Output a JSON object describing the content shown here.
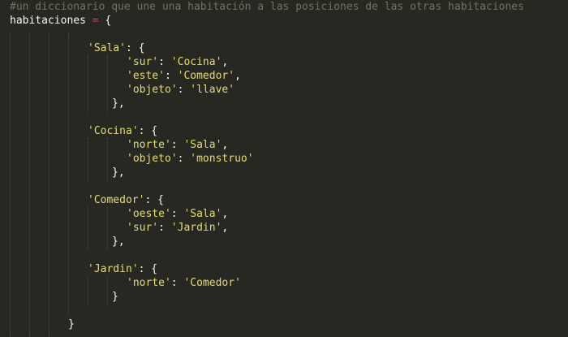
{
  "editor": {
    "comment": "#un diccionario que une una habitación a las posiciones de las otras habitaciones",
    "var_name": "habitaciones",
    "op_assign": "=",
    "open_brace": "{",
    "rooms": [
      {
        "key": "'Sala'",
        "entries": [
          {
            "k": "'sur'",
            "v": "'Cocina'",
            "end": ","
          },
          {
            "k": "'este'",
            "v": "'Comedor'",
            "end": ","
          },
          {
            "k": "'objeto'",
            "v": "'llave'",
            "end": ""
          }
        ],
        "close": "},"
      },
      {
        "key": "'Cocina'",
        "entries": [
          {
            "k": "'norte'",
            "v": "'Sala'",
            "end": ","
          },
          {
            "k": "'objeto'",
            "v": "'monstruo'",
            "end": ""
          }
        ],
        "close": "},"
      },
      {
        "key": "'Comedor'",
        "entries": [
          {
            "k": "'oeste'",
            "v": "'Sala'",
            "end": ","
          },
          {
            "k": "'sur'",
            "v": "'Jardin'",
            "end": ","
          }
        ],
        "close": "},"
      },
      {
        "key": "'Jardin'",
        "entries": [
          {
            "k": "'norte'",
            "v": "'Comedor'",
            "end": ""
          }
        ],
        "close": "}"
      }
    ],
    "close_brace": "}"
  },
  "colors": {
    "background": "#272822",
    "comment": "#75715e",
    "string": "#e6db74",
    "operator": "#f92672",
    "text": "#f8f8f2",
    "guide": "#4a4b44"
  }
}
